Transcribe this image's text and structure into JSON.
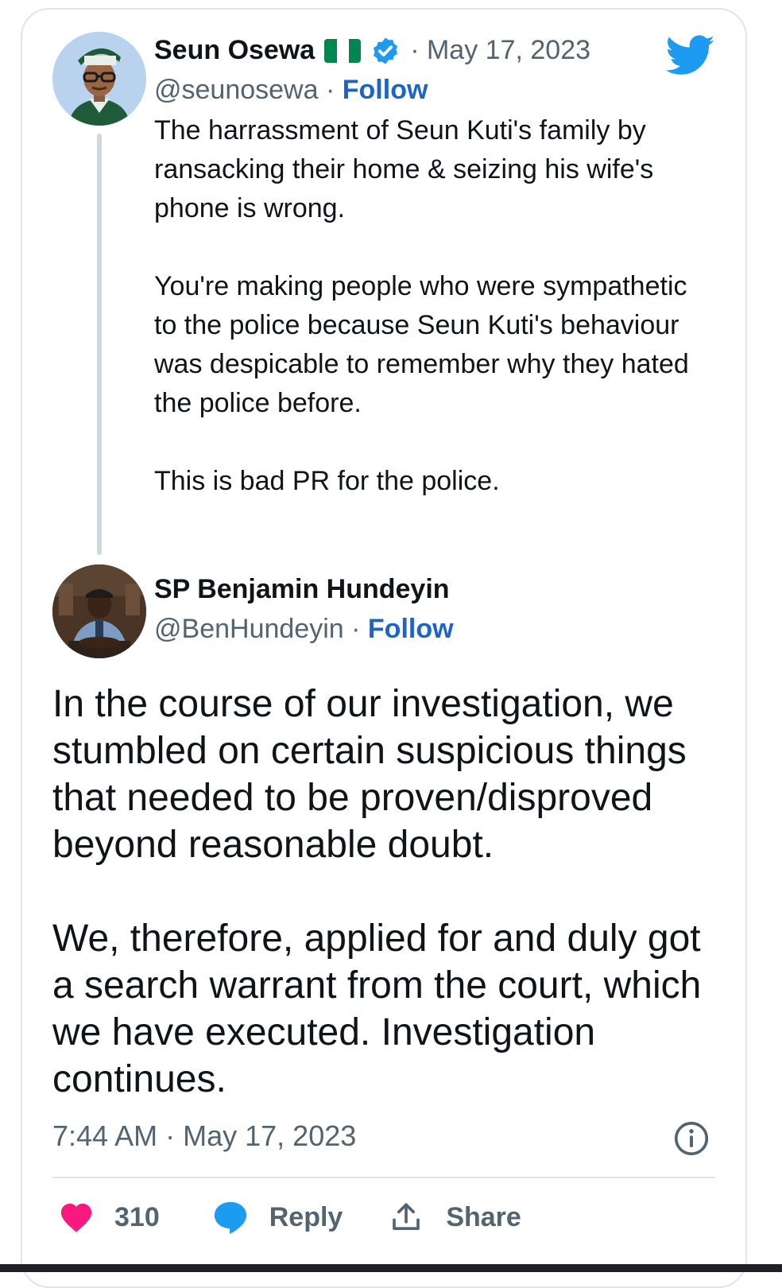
{
  "tweet_parent": {
    "author_name": "Seun Osewa",
    "date": "May 17, 2023",
    "handle": "@seunosewa",
    "follow_label": "Follow",
    "paragraphs": [
      "The harrassment of Seun Kuti's family by ransacking their home & seizing his wife's phone is wrong.",
      "You're making people who were sympathetic to the police because Seun Kuti's behaviour was despicable to remember why they hated the police before.",
      "This is bad PR for the police."
    ]
  },
  "tweet_main": {
    "author_name": "SP Benjamin Hundeyin",
    "handle": "@BenHundeyin",
    "follow_label": "Follow",
    "paragraphs": [
      "In the course of our investigation, we stumbled on certain suspicious things that needed to be proven/disproved beyond reasonable doubt.",
      "We, therefore, applied for and duly got a search warrant from the court, which we have executed. Investigation continues."
    ],
    "time": "7:44 AM",
    "date": "May 17, 2023"
  },
  "actions": {
    "like_count": "310",
    "reply_label": "Reply",
    "share_label": "Share"
  },
  "icons": [
    "verified-badge-icon",
    "nigeria-flag-icon",
    "twitter-bird-icon",
    "info-icon",
    "heart-icon",
    "reply-bubble-icon",
    "share-icon"
  ],
  "colors": {
    "twitter_blue": "#1d9bf0",
    "follow_blue": "#1d64c8",
    "like_red": "#f91880",
    "secondary_text": "#536471",
    "flag_green": "#008751"
  }
}
